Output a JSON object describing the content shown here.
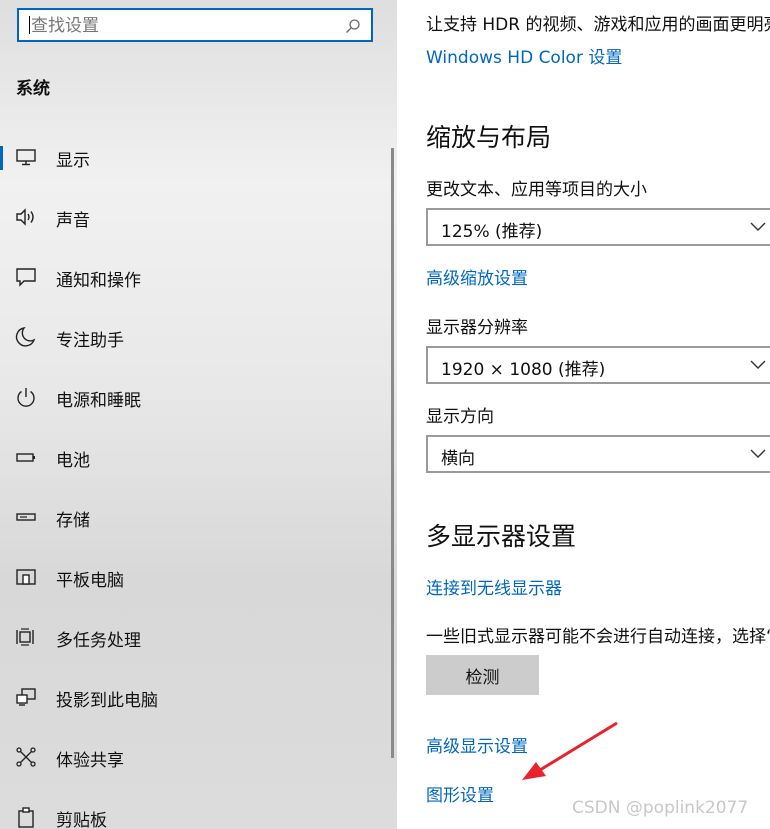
{
  "search": {
    "placeholder": "查找设置"
  },
  "sidebar": {
    "section_title": "系统",
    "items": [
      {
        "label": "显示",
        "icon": "monitor-icon",
        "active": true
      },
      {
        "label": "声音",
        "icon": "speaker-icon"
      },
      {
        "label": "通知和操作",
        "icon": "notification-icon"
      },
      {
        "label": "专注助手",
        "icon": "moon-icon"
      },
      {
        "label": "电源和睡眠",
        "icon": "power-icon"
      },
      {
        "label": "电池",
        "icon": "battery-icon"
      },
      {
        "label": "存储",
        "icon": "storage-icon"
      },
      {
        "label": "平板电脑",
        "icon": "tablet-icon"
      },
      {
        "label": "多任务处理",
        "icon": "multitask-icon"
      },
      {
        "label": "投影到此电脑",
        "icon": "project-icon"
      },
      {
        "label": "体验共享",
        "icon": "share-icon"
      },
      {
        "label": "剪贴板",
        "icon": "clipboard-icon"
      }
    ]
  },
  "main": {
    "hdr_text": "让支持 HDR 的视频、游戏和应用的画面更明亮、更生动。",
    "hdr_link": "Windows HD Color 设置",
    "scale_heading": "缩放与布局",
    "scale_label": "更改文本、应用等项目的大小",
    "scale_value": "125% (推荐)",
    "advanced_scale_link": "高级缩放设置",
    "resolution_label": "显示器分辨率",
    "resolution_value": "1920 × 1080 (推荐)",
    "orientation_label": "显示方向",
    "orientation_value": "横向",
    "multi_heading": "多显示器设置",
    "wireless_link": "连接到无线显示器",
    "detect_text": "一些旧式显示器可能不会进行自动连接，选择“检测”即可尝试手动连接。",
    "detect_button": "检测",
    "advanced_display_link": "高级显示设置",
    "graphics_link": "图形设置"
  },
  "annotation": {
    "arrow_color": "#e8232d"
  },
  "watermark": "CSDN @poplink2077",
  "colors": {
    "accent": "#0067c0"
  }
}
